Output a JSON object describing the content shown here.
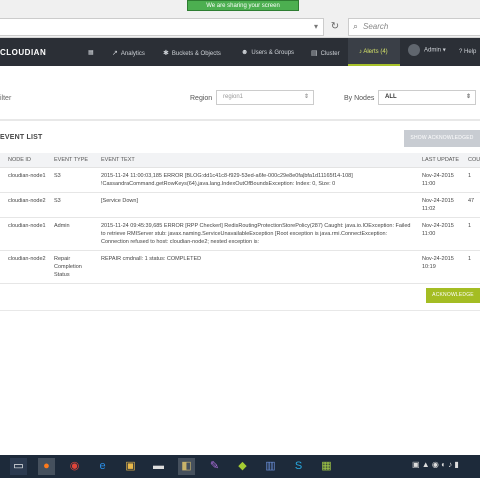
{
  "browser": {
    "sharing_banner": "We are sharing your screen",
    "search_placeholder": "Search",
    "reload_icon": "reload-icon",
    "search_icon": "magnifier-icon"
  },
  "navbar": {
    "logo": "CLOUDIAN",
    "items": [
      {
        "label": "Analytics",
        "icon": "chart-icon"
      },
      {
        "label": "Buckets & Objects",
        "icon": "gear-icon"
      },
      {
        "label": "Users & Groups",
        "icon": "users-icon"
      },
      {
        "label": "Cluster",
        "icon": "server-icon"
      }
    ],
    "alerts": "Alerts (4)",
    "admin": "Admin",
    "help": "Help"
  },
  "filter": {
    "label": "ilter",
    "region_label": "Region",
    "region_value": "region1",
    "bynodes_label": "By Nodes",
    "nodes_value": "ALL"
  },
  "event_list": {
    "header": "EVENT LIST",
    "show_ack_button": "SHOW ACKNOWLEDGED",
    "columns": [
      "NODE ID",
      "EVENT TYPE",
      "EVENT TEXT",
      "LAST UPDATE",
      "COU"
    ],
    "rows": [
      {
        "node": "cloudian-node1",
        "type": "S3",
        "text": "2015-11-24 11:00:03,185 ERROR [BLOG:dd1c41c8-f929-53ed-a6fe-000c29e8e0fa|bfa1d11165f14-108] !CassandraCommand.getRowKeys(64),java.lang.IndexOutOfBoundsException: Index: 0, Size: 0",
        "date": "Nov-24-2015",
        "time": "11:00",
        "count": "1"
      },
      {
        "node": "cloudian-node2",
        "type": "S3",
        "text": "[Service Down]",
        "date": "Nov-24-2015",
        "time": "11:02",
        "count": "47"
      },
      {
        "node": "cloudian-node1",
        "type": "Admin",
        "text": "2015-11-24 09:45:39,685 ERROR [RPP Checkerl] RedisRoutingProtectionStorePolicy(287) Caught: java.io.IOException: Failed to retrieve RMIServer stub: javax.naming.ServiceUnavailableException [Root exception is java.rmi.ConnectException: Connection refused to host: cloudian-node2; nested exception is:",
        "date": "Nov-24-2015",
        "time": "11:00",
        "count": "1"
      },
      {
        "node": "cloudian-node2",
        "type": "Repair Completion Status",
        "text": "REPAIR cmdnall: 1 status: COMPLETED",
        "date": "Nov-24-2015",
        "time": "10:19",
        "count": "1"
      }
    ],
    "ack_button": "ACKNOWLEDGE"
  },
  "taskbar": {
    "items": [
      "explorer-icon",
      "firefox-icon",
      "chrome-icon",
      "ie-icon",
      "folder-icon",
      "terminal-icon",
      "app-icon",
      "paint-icon",
      "gradle-icon",
      "remote-icon",
      "skype-icon",
      "vm-icon"
    ]
  }
}
